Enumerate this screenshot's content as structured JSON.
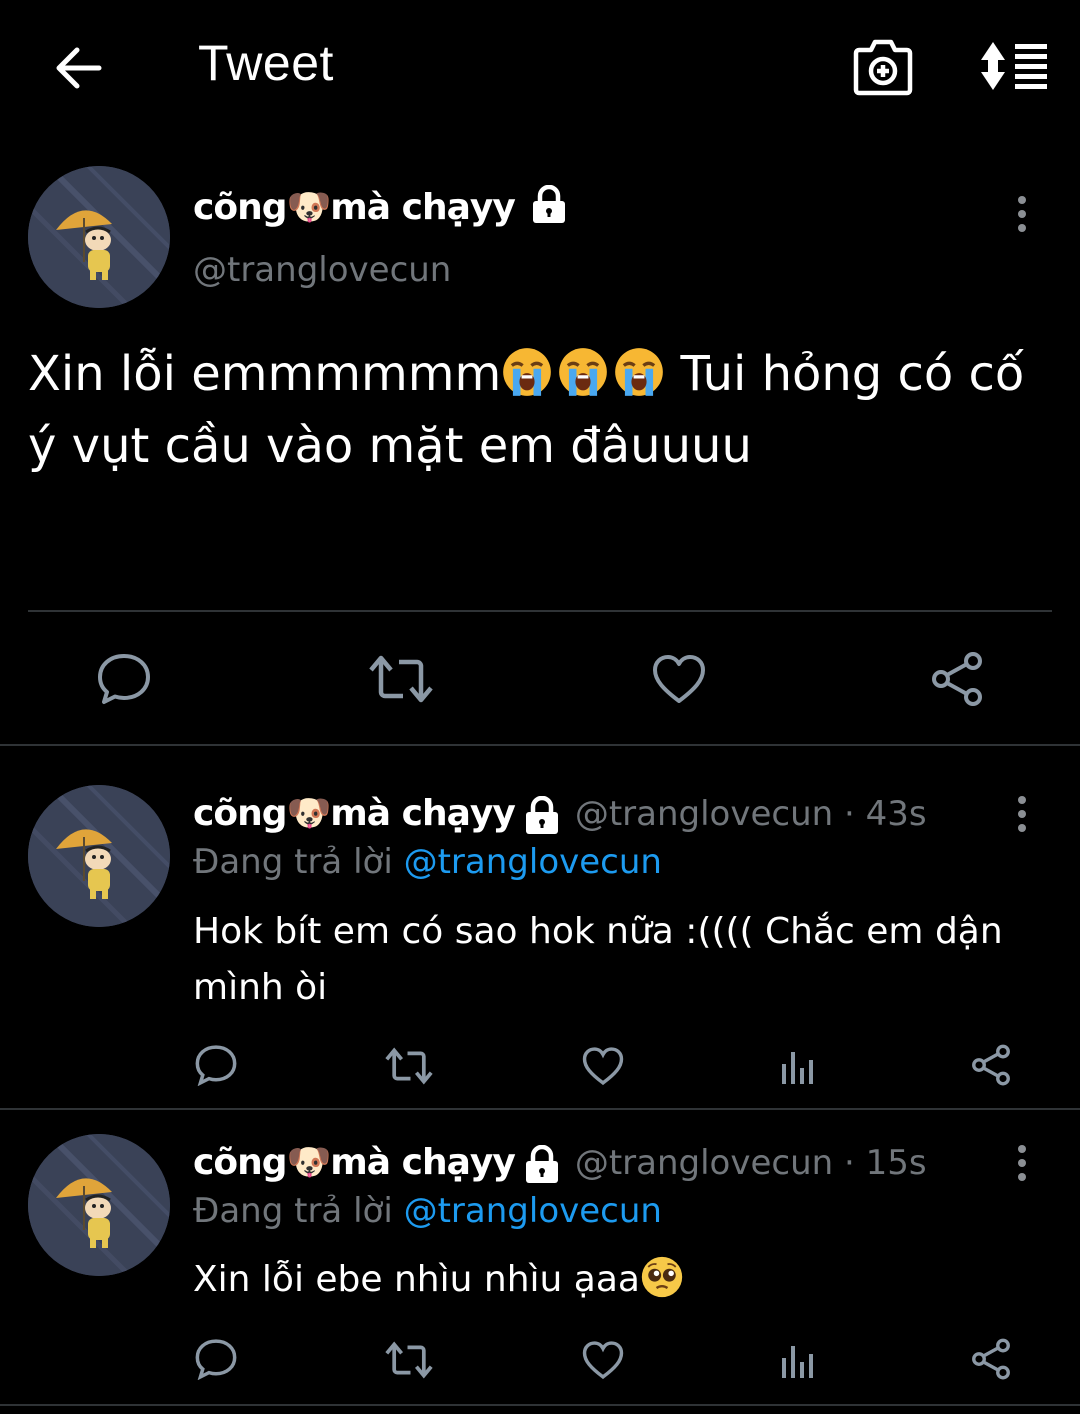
{
  "header": {
    "title": "Tweet"
  },
  "tweet": {
    "display_name": "cõng🐶mà chạyy",
    "handle": "@tranglovecun",
    "text_part1": "Xin lỗi emmmmmm",
    "text_part2": " Tui hỏng có cố ý vụt cầu vào mặt em đâuuuu",
    "text_emojis": [
      "loudly-crying-face",
      "loudly-crying-face",
      "loudly-crying-face"
    ]
  },
  "replies": [
    {
      "display_name": "cõng🐶mà chạyy",
      "meta": "@tranglovecun · 43s",
      "replying_prefix": "Đang trả lời",
      "replying_to": "@tranglovecun",
      "text": "Hok bít em có sao hok nữa :(((( Chắc em dận mình òi"
    },
    {
      "display_name": "cõng🐶mà chạyy",
      "meta": "@tranglovecun · 15s",
      "replying_prefix": "Đang trả lời",
      "replying_to": "@tranglovecun",
      "text": "Xin lỗi ebe nhìu nhìu ạaa",
      "trailing_emoji": "pleading-face"
    }
  ],
  "icons": {
    "back": "arrow-left-icon",
    "camera": "camera-plus-icon",
    "sort": "sort-list-icon",
    "lock": "lock-icon",
    "more": "more-vertical-icon",
    "reply": "reply-icon",
    "retweet": "retweet-icon",
    "like": "heart-icon",
    "share": "share-icon",
    "analytics": "analytics-icon"
  },
  "colors": {
    "background": "#000000",
    "text": "#ffffff",
    "secondary": "#71767b",
    "link": "#1d9bf0",
    "divider": "#2f3336"
  }
}
